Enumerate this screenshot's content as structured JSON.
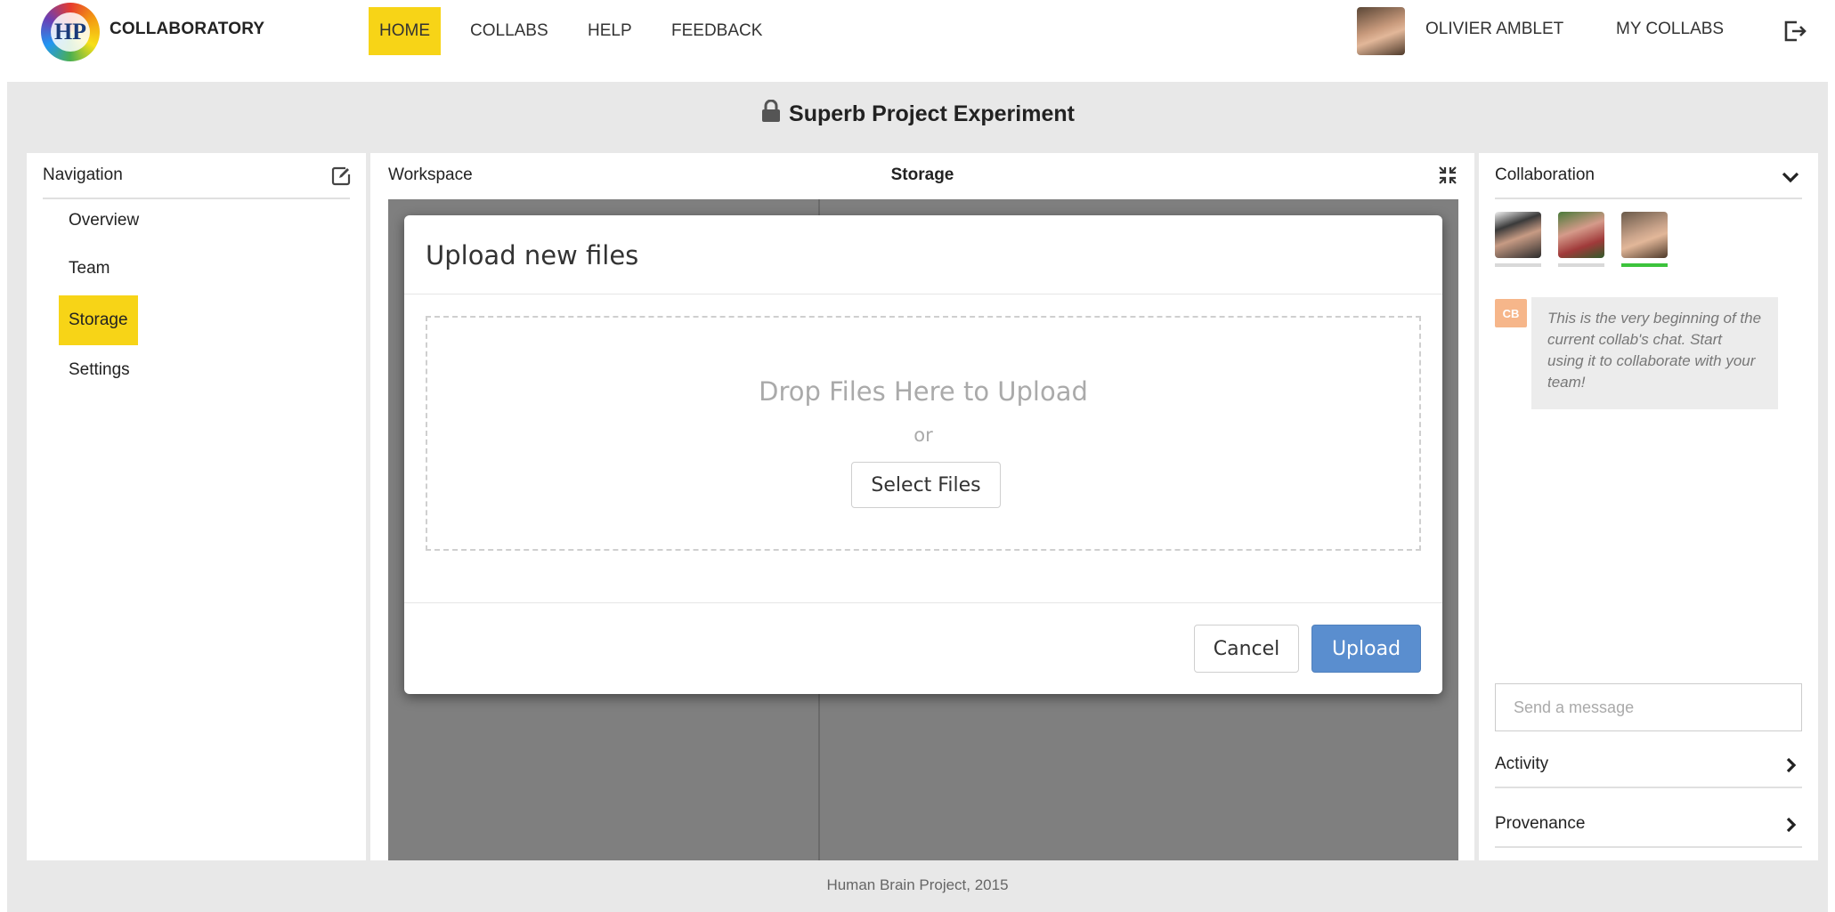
{
  "header": {
    "brand": "COLLABORATORY",
    "logo_text": "HP",
    "nav": [
      "HOME",
      "COLLABS",
      "HELP",
      "FEEDBACK"
    ],
    "active_nav": "HOME",
    "user_name": "OLIVIER AMBLET",
    "my_collabs": "MY COLLABS"
  },
  "project": {
    "title": "Superb Project Experiment"
  },
  "navigation": {
    "title": "Navigation",
    "items": [
      "Overview",
      "Team",
      "Storage",
      "Settings"
    ],
    "active": "Storage"
  },
  "workspace": {
    "title": "Workspace",
    "subtitle": "Storage"
  },
  "modal": {
    "title": "Upload new files",
    "drop_text": "Drop Files Here to Upload",
    "or_text": "or",
    "select_label": "Select Files",
    "cancel_label": "Cancel",
    "upload_label": "Upload"
  },
  "collaboration": {
    "title": "Collaboration",
    "chat_badge": "CB",
    "chat_message": "This is the very beginning of the current collab's chat. Start using it to collaborate with your team!",
    "message_placeholder": "Send a message",
    "activity": "Activity",
    "provenance": "Provenance"
  },
  "footer": {
    "text": "Human Brain Project, 2015"
  },
  "colors": {
    "highlight": "#f7d417",
    "primary_button": "#5a8ecf",
    "online": "#3cc33c",
    "chat_badge": "#f6b68a"
  }
}
